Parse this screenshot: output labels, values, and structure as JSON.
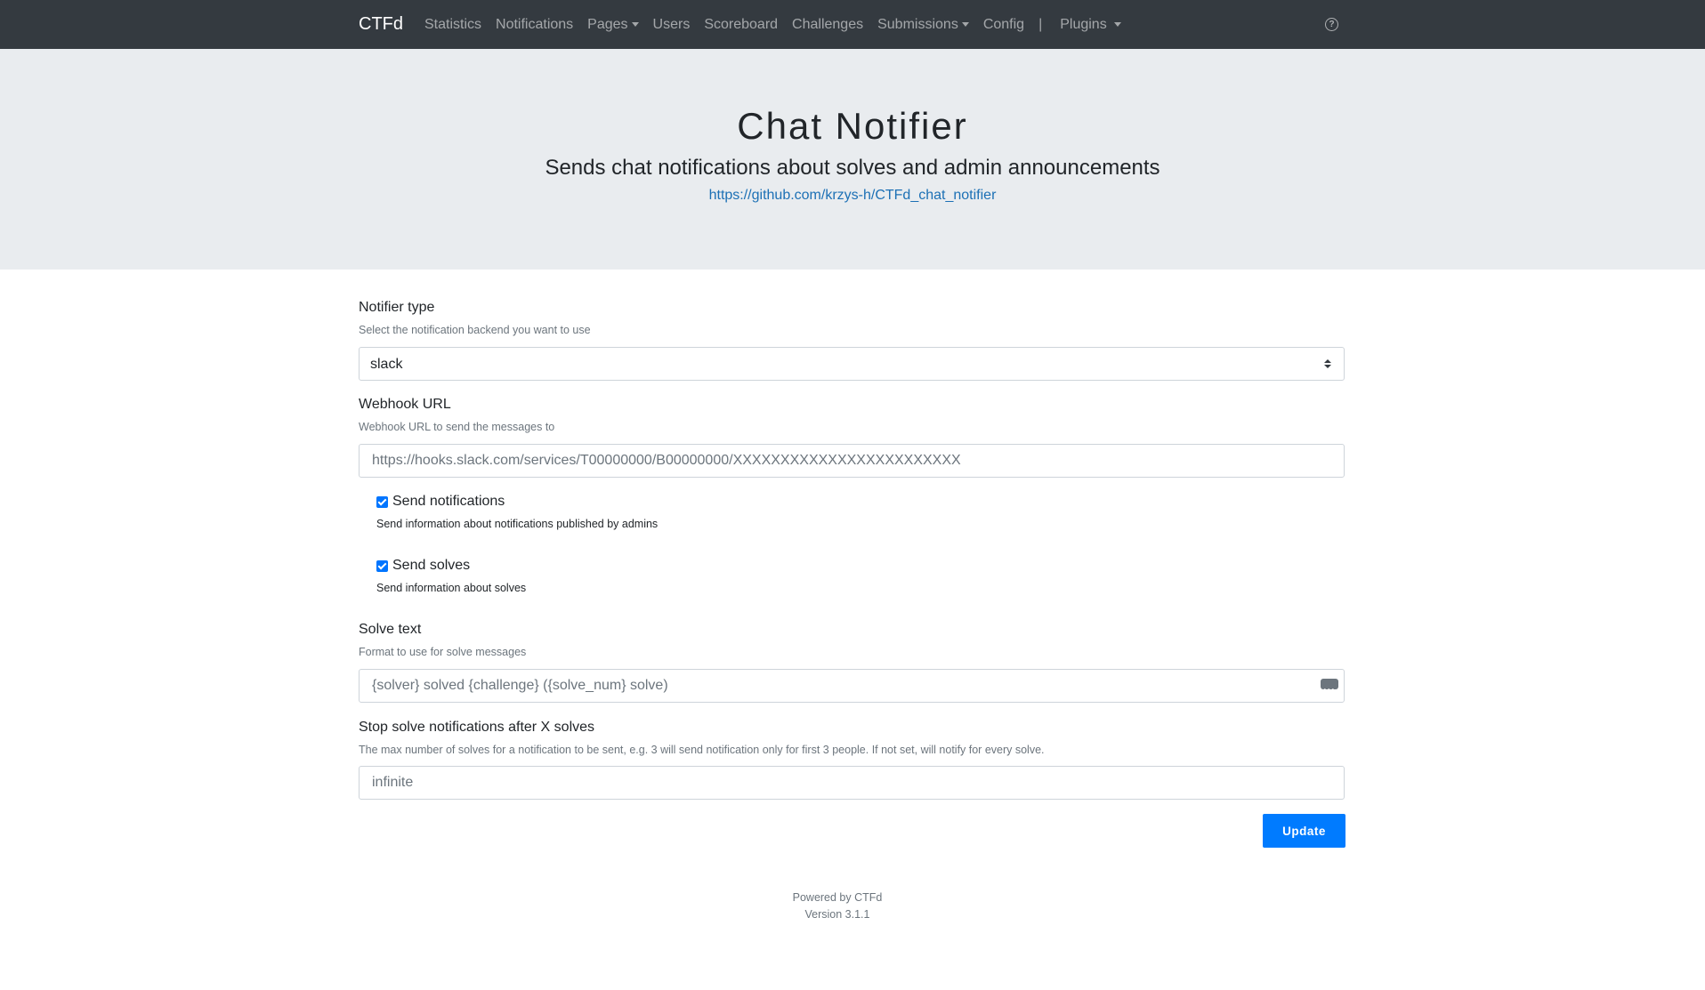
{
  "navbar": {
    "brand": "CTFd",
    "items": [
      {
        "label": "Statistics",
        "dropdown": false
      },
      {
        "label": "Notifications",
        "dropdown": false
      },
      {
        "label": "Pages",
        "dropdown": true
      },
      {
        "label": "Users",
        "dropdown": false
      },
      {
        "label": "Scoreboard",
        "dropdown": false
      },
      {
        "label": "Challenges",
        "dropdown": false
      },
      {
        "label": "Submissions",
        "dropdown": true
      },
      {
        "label": "Config",
        "dropdown": false
      }
    ],
    "divider": "|",
    "plugins_label": "Plugins",
    "help_icon": "question-circle-icon"
  },
  "jumbotron": {
    "title": "Chat Notifier",
    "subtitle": "Sends chat notifications about solves and admin announcements",
    "link": "https://github.com/krzys-h/CTFd_chat_notifier"
  },
  "form": {
    "notifier_type": {
      "label": "Notifier type",
      "help": "Select the notification backend you want to use",
      "value": "slack"
    },
    "webhook_url": {
      "label": "Webhook URL",
      "help": "Webhook URL to send the messages to",
      "placeholder": "https://hooks.slack.com/services/T00000000/B00000000/XXXXXXXXXXXXXXXXXXXXXXXX"
    },
    "send_notifications": {
      "label": "Send notifications",
      "help": "Send information about notifications published by admins",
      "checked": true
    },
    "send_solves": {
      "label": "Send solves",
      "help": "Send information about solves",
      "checked": true
    },
    "solve_text": {
      "label": "Solve text",
      "help": "Format to use for solve messages",
      "placeholder": "{solver} solved {challenge} ({solve_num} solve)"
    },
    "solve_limit": {
      "label": "Stop solve notifications after X solves",
      "help": "The max number of solves for a notification to be sent, e.g. 3 will send notification only for first 3 people. If not set, will notify for every solve.",
      "placeholder": "infinite"
    },
    "update_label": "Update"
  },
  "footer": {
    "powered": "Powered by CTFd",
    "version": "Version 3.1.1"
  }
}
